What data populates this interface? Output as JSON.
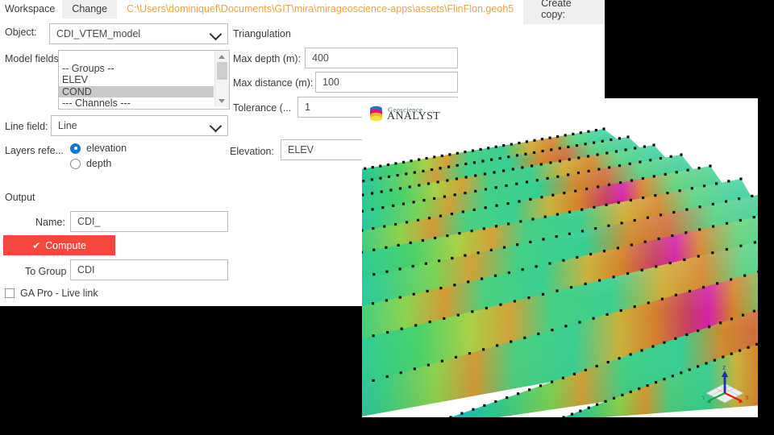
{
  "window": {
    "background_color": "#000000",
    "panel_color": "#ffffff"
  },
  "toolbar": {
    "workspace_label": "Workspace",
    "change_label": "Change",
    "path": "C:\\Users\\dominiquef\\Documents\\GIT\\mira\\mirageoscience-apps\\assets\\FlinFlon.geoh5",
    "path_color": "#f2a24a",
    "create_copy_label": "Create copy:"
  },
  "form": {
    "object": {
      "label": "Object:",
      "value": "CDI_VTEM_model",
      "chevron_icon": "chevron-down-icon"
    },
    "triangulation_label": "Triangulation",
    "model_fields": {
      "label": "Model fields:",
      "items": [
        "",
        "-- Groups --",
        "ELEV",
        "COND",
        "--- Channels ---"
      ],
      "selected": "COND",
      "selected_index": 3
    },
    "max_depth": {
      "label": "Max depth (m):",
      "value": "400"
    },
    "max_distance": {
      "label": "Max distance (m):",
      "value": "100"
    },
    "tolerance": {
      "label": "Tolerance (...",
      "value": "1"
    },
    "line_field": {
      "label": "Line field:",
      "value": "Line",
      "chevron_icon": "chevron-down-icon"
    },
    "layers_reference": {
      "label": "Layers refe...",
      "options": [
        "elevation",
        "depth"
      ],
      "selected": "elevation",
      "accent_color": "#1675d1"
    },
    "elevation": {
      "label": "Elevation:",
      "value": "ELEV"
    }
  },
  "output": {
    "section_label": "Output",
    "name": {
      "label": "Name:",
      "value": "CDI_"
    },
    "compute": {
      "label": "Compute",
      "check_icon": "check-icon",
      "color": "#f4483c"
    },
    "to_group": {
      "label": "To Group",
      "value": "CDI"
    },
    "live_link": {
      "label": "GA Pro - Live link",
      "checked": false,
      "checkbox_icon": "checkbox-icon"
    }
  },
  "viewport": {
    "logo": {
      "mark_icon": "geoscience-analyst-logo-icon",
      "line1": "Geoscience",
      "line2": "ANALYST"
    },
    "gizmo": {
      "x_label": "X",
      "y_label": "Y",
      "z_label": "Z",
      "x_color": "#e01b1b",
      "y_color": "#11a53c",
      "z_color": "#1c2fb0"
    },
    "model": {
      "description": "3D curtain sections of CDI conductivity model",
      "section_count": 11,
      "colormap": [
        "#16b5c8",
        "#2fd08a",
        "#6fd84a",
        "#c9c636",
        "#d98c2c",
        "#cf3f6a",
        "#d421a8"
      ]
    }
  }
}
